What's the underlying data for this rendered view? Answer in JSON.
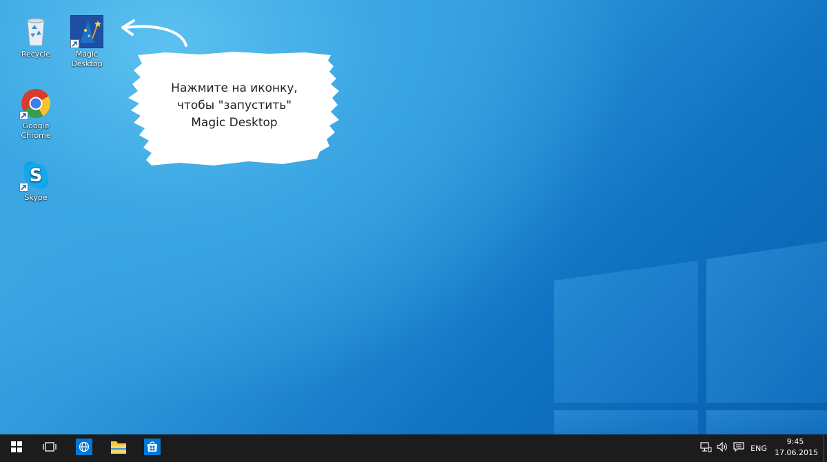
{
  "desktop": {
    "icons": [
      {
        "label": "Recycle",
        "icon": "recycle-bin-icon"
      },
      {
        "label": "Magic\nDesktop",
        "icon": "magic-desktop-icon"
      },
      {
        "label": "Google\nChrome",
        "icon": "chrome-icon"
      },
      {
        "label": "Skype",
        "icon": "skype-icon"
      }
    ],
    "callout": {
      "text": "Нажмите на иконку,\nчтобы \"запустить\"\nMagic Desktop"
    }
  },
  "taskbar": {
    "buttons": [
      "start-icon",
      "task-view-icon",
      "edge-icon",
      "file-explorer-icon",
      "store-icon"
    ],
    "tray": {
      "icons": [
        "network-icon",
        "volume-icon",
        "notifications-icon"
      ],
      "language": "ENG",
      "time": "9:45",
      "date": "17.06.2015"
    }
  },
  "colors": {
    "taskbar": "#1c1c1c",
    "wallpaper": "#0a76c4",
    "accent": "#0078d7"
  }
}
